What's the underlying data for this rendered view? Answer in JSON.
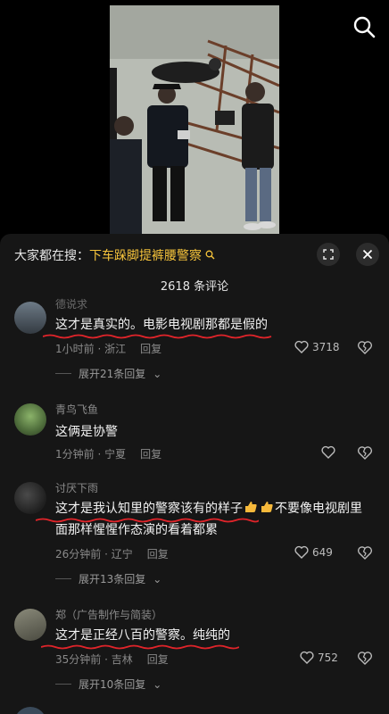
{
  "header": {
    "search_icon": "search-icon"
  },
  "panel": {
    "suggest_prefix": "大家都在搜：",
    "suggest_keyword": "下车跺脚提裤腰警察",
    "suggest_icon": "magnifier-icon",
    "collapse_icon": "collapse-icon",
    "close_icon": "close-icon",
    "comment_count": "2618 条评论"
  },
  "comments": [
    {
      "user": "德说求",
      "text": "这才是真实的。电影电视剧那都是假的",
      "time_location": "1小时前 · 浙江",
      "reply_label": "回复",
      "likes": "3718",
      "expand": "展开21条回复"
    },
    {
      "user": "青鸟飞鱼",
      "text": "这俩是协警",
      "time_location": "1分钟前 · 宁夏",
      "reply_label": "回复",
      "likes": "",
      "expand": ""
    },
    {
      "user": "讨厌下雨",
      "text_part1": "这才是我认知里的警察该有的样子",
      "text_part2": "不要像电视剧里面那样惺惺作态演的看着都累",
      "time_location": "26分钟前 · 辽宁",
      "reply_label": "回复",
      "likes": "649",
      "expand": "展开13条回复"
    },
    {
      "user": "郑（广告制作与简装）",
      "text": "这才是正经八百的警察。纯纯的",
      "time_location": "35分钟前 · 吉林",
      "reply_label": "回复",
      "likes": "752",
      "expand": "展开10条回复"
    }
  ],
  "colors": {
    "keyword": "#f5c33b",
    "panel_bg": "#161616",
    "underline": "#e0242a"
  }
}
